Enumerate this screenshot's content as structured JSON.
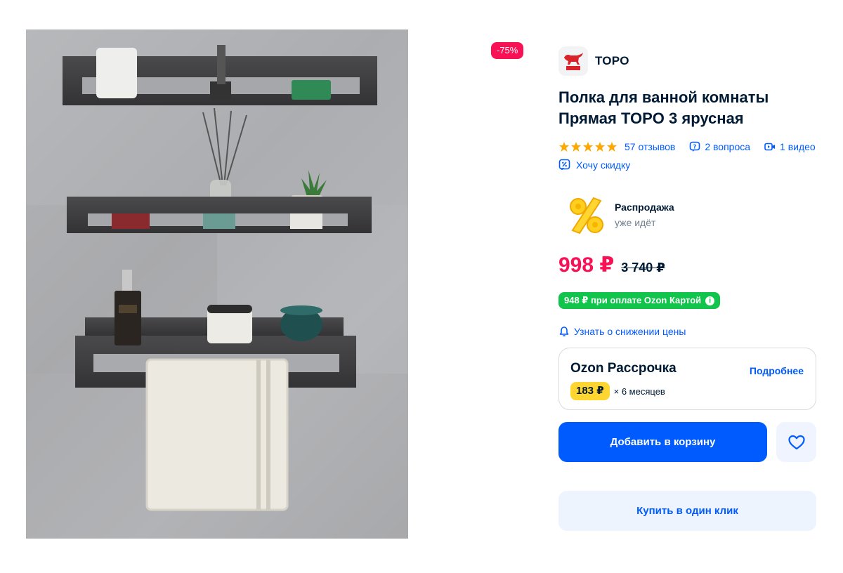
{
  "product": {
    "discount_badge": "-75%",
    "brand": "TOPO",
    "title": "Полка для ванной комнаты Прямая TOPO 3 ярусная",
    "rating_stars": 5,
    "reviews": "57 отзывов",
    "questions": "2 вопроса",
    "videos": "1 видео",
    "want_discount": "Хочу скидку"
  },
  "sale": {
    "title": "Распродажа",
    "subtitle": "уже идёт"
  },
  "pricing": {
    "price": "998 ₽",
    "old_price": "3 740 ₽",
    "card_price": "948 ₽ при оплате Ozon Картой",
    "price_alert": "Узнать о снижении цены"
  },
  "installment": {
    "title": "Ozon Рассрочка",
    "more_link": "Подробнее",
    "monthly": "183 ₽",
    "term": "× 6 месяцев"
  },
  "actions": {
    "add_to_cart": "Добавить в корзину",
    "buy_one_click": "Купить в один клик"
  },
  "colors": {
    "accent_blue": "#005bff",
    "discount_pink": "#f91155",
    "card_green": "#10c44c",
    "installment_yellow": "#ffd62f",
    "star_yellow": "#ffa800"
  },
  "icons": {
    "questions": "question-bubble-icon",
    "videos": "video-icon",
    "want_discount": "percent-tag-icon",
    "price_alert": "bell-icon",
    "favorite": "heart-icon",
    "info": "info-icon"
  }
}
